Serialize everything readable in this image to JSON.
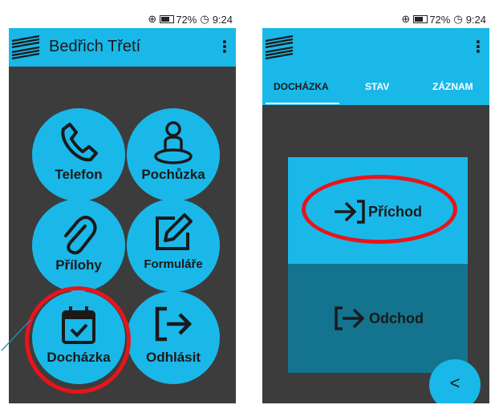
{
  "status_bar": {
    "battery": "72%",
    "time": "9:24"
  },
  "left_screen": {
    "app_title": "Bedřich Třetí",
    "tiles": {
      "telefon": "Telefon",
      "pochuzka": "Pochůzka",
      "prilohy": "Přílohy",
      "formulare": "Formuláře",
      "dochazka": "Docházka",
      "odhlasit": "Odhlásit"
    }
  },
  "right_screen": {
    "tabs": [
      "DOCHÁZKA",
      "STAV",
      "ZÁZNAM"
    ],
    "active_tab": "DOCHÁZKA",
    "check_in_label": "Příchod",
    "check_out_label": "Odchod",
    "back_button_glyph": "<"
  },
  "colors": {
    "accent": "#1ab8e8",
    "dark_accent": "#14738f",
    "background": "#3c3c3c",
    "highlight_ring": "#e8141b"
  },
  "icons": [
    "phone-icon",
    "person-location-icon",
    "paperclip-icon",
    "edit-icon",
    "calendar-check-icon",
    "logout-icon",
    "login-icon",
    "more-vert-icon",
    "chevron-left-icon",
    "logo-icon"
  ]
}
